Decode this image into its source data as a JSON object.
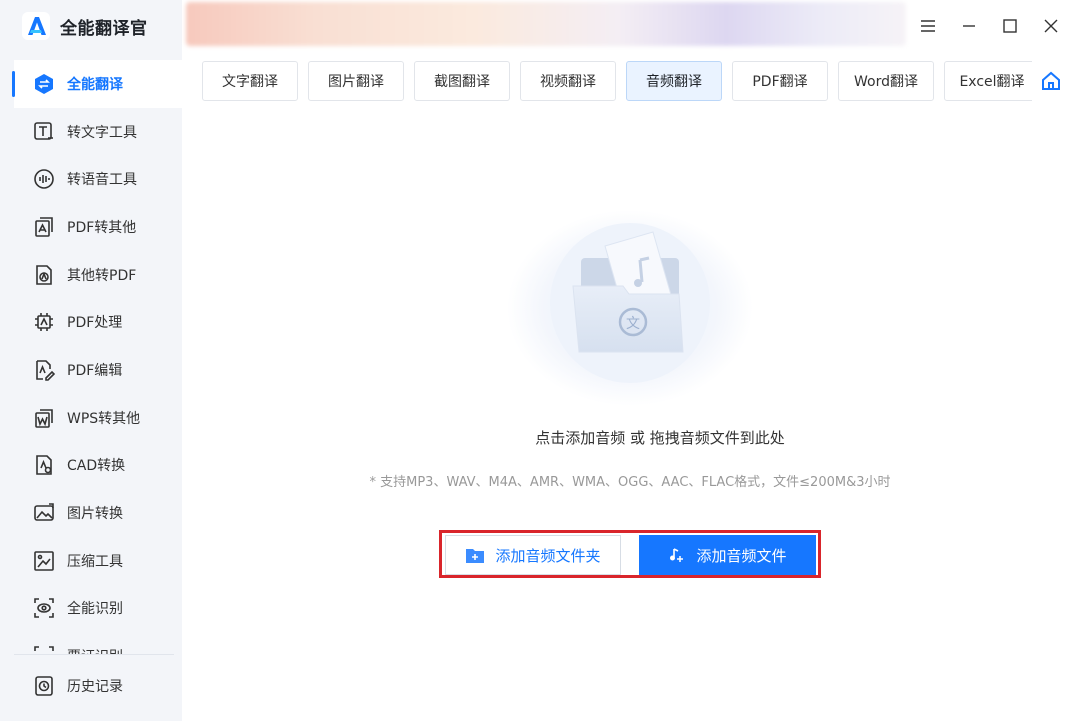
{
  "app": {
    "title": "全能翻译官"
  },
  "sidebar": {
    "items": [
      {
        "label": "全能翻译",
        "icon": "translate-swap-icon",
        "active": true
      },
      {
        "label": "转文字工具",
        "icon": "text-convert-icon"
      },
      {
        "label": "转语音工具",
        "icon": "voice-icon"
      },
      {
        "label": "PDF转其他",
        "icon": "pdf-export-icon"
      },
      {
        "label": "其他转PDF",
        "icon": "pdf-import-icon"
      },
      {
        "label": "PDF处理",
        "icon": "pdf-process-icon"
      },
      {
        "label": "PDF编辑",
        "icon": "pdf-edit-icon"
      },
      {
        "label": "WPS转其他",
        "icon": "wps-icon"
      },
      {
        "label": "CAD转换",
        "icon": "cad-icon"
      },
      {
        "label": "图片转换",
        "icon": "image-convert-icon"
      },
      {
        "label": "压缩工具",
        "icon": "compress-icon"
      },
      {
        "label": "全能识别",
        "icon": "recognize-icon"
      },
      {
        "label": "票证识别",
        "icon": "scan-icon"
      }
    ],
    "history": {
      "label": "历史记录",
      "icon": "history-icon"
    }
  },
  "tabs": [
    {
      "label": "文字翻译",
      "w": 96
    },
    {
      "label": "图片翻译",
      "w": 96
    },
    {
      "label": "截图翻译",
      "w": 96
    },
    {
      "label": "视频翻译",
      "w": 96
    },
    {
      "label": "音频翻译",
      "w": 96,
      "active": true
    },
    {
      "label": "PDF翻译",
      "w": 96
    },
    {
      "label": "Word翻译",
      "w": 96
    },
    {
      "label": "Excel翻译",
      "w": 96
    }
  ],
  "main": {
    "hint": "点击添加音频 或 拖拽音频文件到此处",
    "formats": "* 支持MP3、WAV、M4A、AMR、WMA、OGG、AAC、FLAC格式，文件≤200M&3小时",
    "btn_folder": "添加音频文件夹",
    "btn_file": "添加音频文件"
  },
  "colors": {
    "accent": "#1677ff",
    "highlight": "#d9252b",
    "sidebar_bg": "#f3f5f9"
  }
}
